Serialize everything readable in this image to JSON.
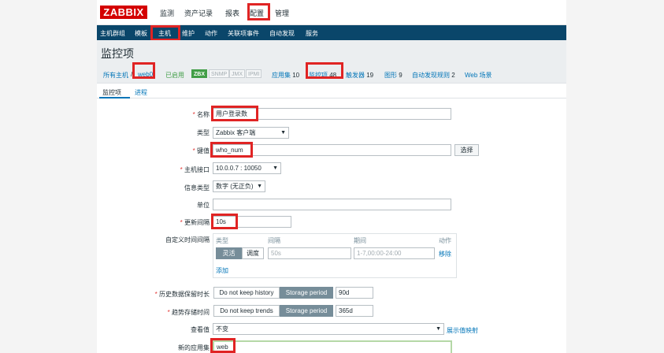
{
  "topbar": {
    "logo": "ZABBIX",
    "menu": [
      "监测",
      "资产记录",
      "报表",
      "配置",
      "管理"
    ]
  },
  "submenu": [
    "主机群组",
    "模板",
    "主机",
    "维护",
    "动作",
    "关联项事件",
    "自动发现",
    "服务"
  ],
  "page_title": "监控项",
  "breadcrumbs": {
    "all_hosts": "所有主机",
    "separator": "/",
    "host": "web0",
    "status": "已启用",
    "availability": [
      "ZBX",
      "SNMP",
      "JMX",
      "IPMI"
    ],
    "links": [
      {
        "label": "应用集",
        "count": "10"
      },
      {
        "label": "监控项",
        "count": "48"
      },
      {
        "label": "触发器",
        "count": "19"
      },
      {
        "label": "图形",
        "count": "9"
      },
      {
        "label": "自动发现规则",
        "count": "2"
      },
      {
        "label": "Web 场景",
        "count": ""
      }
    ]
  },
  "tabs": [
    "监控项",
    "进程"
  ],
  "form": {
    "name": {
      "label": "名称",
      "value": "用户登录数"
    },
    "type": {
      "label": "类型",
      "value": "Zabbix 客户端"
    },
    "key": {
      "label": "键值",
      "value": "who_num",
      "button": "选择"
    },
    "host_interface": {
      "label": "主机接口",
      "value": "10.0.0.7 : 10050"
    },
    "info_type": {
      "label": "信息类型",
      "value": "数字 (无正负)"
    },
    "units": {
      "label": "单位",
      "value": ""
    },
    "update_interval": {
      "label": "更新间隔",
      "value": "10s"
    },
    "custom_intervals": {
      "label": "自定义时间间隔",
      "headers": [
        "类型",
        "间隔",
        "期间",
        "动作"
      ],
      "type_options": [
        "灵活",
        "调度"
      ],
      "interval_placeholder": "50s",
      "period_placeholder": "1-7,00:00-24:00",
      "remove": "移除",
      "add": "添加"
    },
    "history": {
      "label": "历史数据保留时长",
      "options": [
        "Do not keep history",
        "Storage period"
      ],
      "value": "90d"
    },
    "trends": {
      "label": "趋势存储时间",
      "options": [
        "Do not keep trends",
        "Storage period"
      ],
      "value": "365d"
    },
    "show_value": {
      "label": "查看值",
      "value": "不变",
      "link": "展示值映射"
    },
    "new_application": {
      "label": "新的应用集",
      "value": "web"
    }
  },
  "colors": {
    "accent_red": "#e02424",
    "logo_red": "#d40000",
    "nav_blue": "#0a466a",
    "link_blue": "#0275b8",
    "green": "#429e47"
  }
}
